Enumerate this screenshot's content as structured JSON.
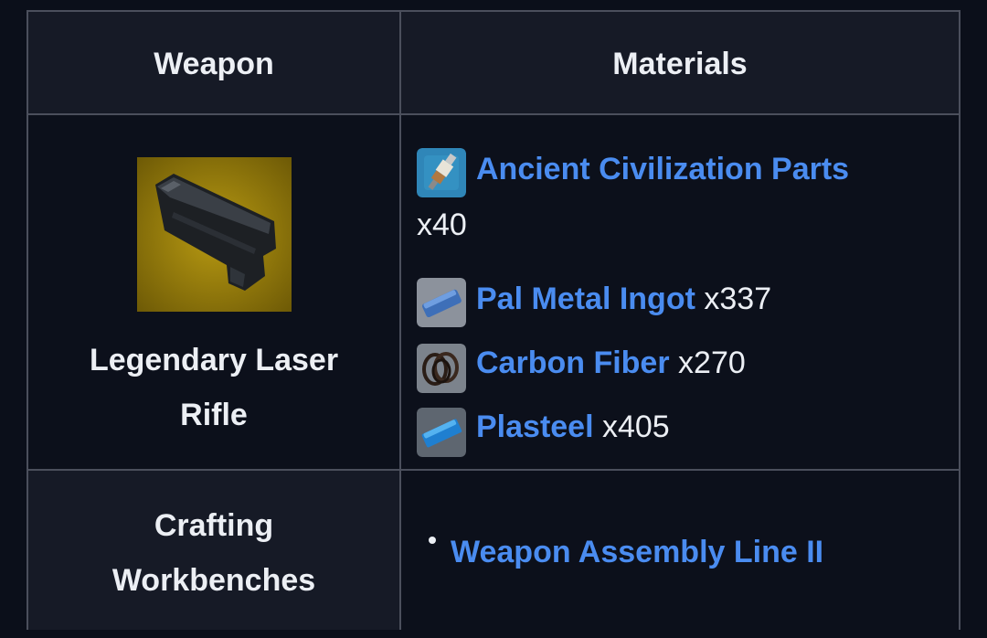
{
  "table": {
    "headers": {
      "weapon": "Weapon",
      "materials": "Materials"
    },
    "weapon": {
      "name_line1": "Legendary Laser",
      "name_line2": "Rifle",
      "icon": "laser-rifle-icon"
    },
    "materials": [
      {
        "name": "Ancient Civilization Parts",
        "qty": "x40",
        "icon": "spark-plug-icon"
      },
      {
        "name": "Pal Metal Ingot",
        "qty": "x337",
        "icon": "metal-ingot-icon"
      },
      {
        "name": "Carbon Fiber",
        "qty": "x270",
        "icon": "carbon-fiber-icon"
      },
      {
        "name": "Plasteel",
        "qty": "x405",
        "icon": "plasteel-icon"
      }
    ],
    "crafting": {
      "label_line1": "Crafting",
      "label_line2": "Workbenches",
      "workbenches": [
        "Weapon Assembly Line II"
      ]
    }
  },
  "colors": {
    "background": "#0b0f1a",
    "header_bg": "#161a26",
    "border": "#4b4f5c",
    "link": "#4a8cf0",
    "text": "#eceff4"
  }
}
